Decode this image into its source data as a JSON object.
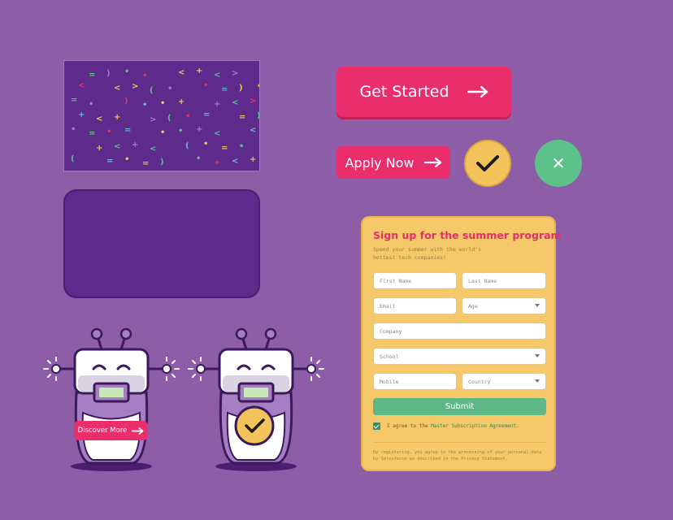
{
  "buttons": {
    "get_started": "Get Started",
    "apply_now": "Apply Now",
    "discover_more": "Discover More"
  },
  "icons": {
    "arrow": "right-arrow-icon",
    "check": "checkmark-icon",
    "close": "close-icon",
    "close_glyph": "✕"
  },
  "colors": {
    "background": "#8d5ea7",
    "panel": "#5e2a8c",
    "primary": "#ea2e6b",
    "yellow": "#f3c45b",
    "green": "#5cc28a"
  },
  "form": {
    "title": "Sign up for the summer program",
    "subtitle": "Spend your summer with the world's hottest tech companies!",
    "fields": {
      "first_name": "First Name",
      "last_name": "Last Name",
      "email": "Email",
      "age": "Age",
      "company": "Company",
      "school": "School",
      "mobile": "Mobile",
      "country": "Country"
    },
    "submit": "Submit",
    "agree_prefix": "I agree to the ",
    "agree_link": "Master Subscription Agreement",
    "agree_suffix": ".",
    "agree_checked": true,
    "disclaimer": "By registering, you agree to the processing of your personal data by Salesforce as described in the Privacy Statement."
  }
}
